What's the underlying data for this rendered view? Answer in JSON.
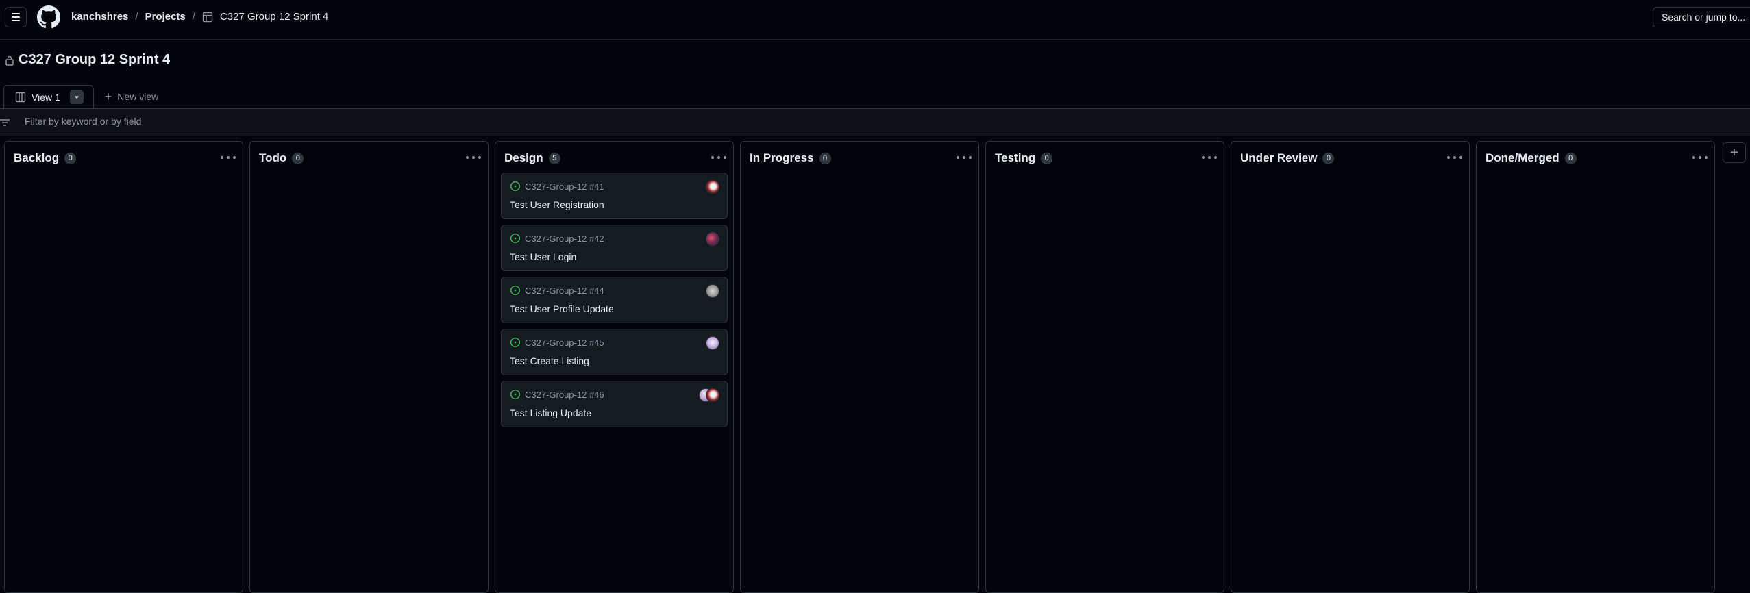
{
  "header": {
    "owner": "kanchshres",
    "projects_link": "Projects",
    "project_name": "C327 Group 12 Sprint 4",
    "separator": "/",
    "search_label": "Search or jump to..."
  },
  "project": {
    "title": "C327 Group 12 Sprint 4"
  },
  "views": {
    "active_label": "View 1",
    "new_view_label": "New view"
  },
  "filter": {
    "placeholder": "Filter by keyword or by field"
  },
  "columns": [
    {
      "name": "Backlog",
      "count": "0",
      "cards": []
    },
    {
      "name": "Todo",
      "count": "0",
      "cards": []
    },
    {
      "name": "Design",
      "count": "5",
      "cards": [
        {
          "ref": "C327-Group-12 #41",
          "title": "Test User Registration"
        },
        {
          "ref": "C327-Group-12 #42",
          "title": "Test User Login"
        },
        {
          "ref": "C327-Group-12 #44",
          "title": "Test User Profile Update"
        },
        {
          "ref": "C327-Group-12 #45",
          "title": "Test Create Listing"
        },
        {
          "ref": "C327-Group-12 #46",
          "title": "Test Listing Update"
        }
      ]
    },
    {
      "name": "In Progress",
      "count": "0",
      "cards": []
    },
    {
      "name": "Testing",
      "count": "0",
      "cards": []
    },
    {
      "name": "Under Review",
      "count": "0",
      "cards": []
    },
    {
      "name": "Done/Merged",
      "count": "0",
      "cards": []
    }
  ],
  "icons": {
    "menu": "hamburger-icon",
    "logo": "github-logo-icon",
    "table": "table-icon",
    "lock": "lock-icon",
    "view": "board-view-icon",
    "issue": "issue-open-icon",
    "more": "kebab-horizontal-icon",
    "add": "plus-icon"
  },
  "colors": {
    "background": "#010409",
    "panel": "#161b22",
    "border": "#30363d",
    "text": "#e6edf3",
    "muted": "#9198a1",
    "issue_open": "#3fb950"
  }
}
